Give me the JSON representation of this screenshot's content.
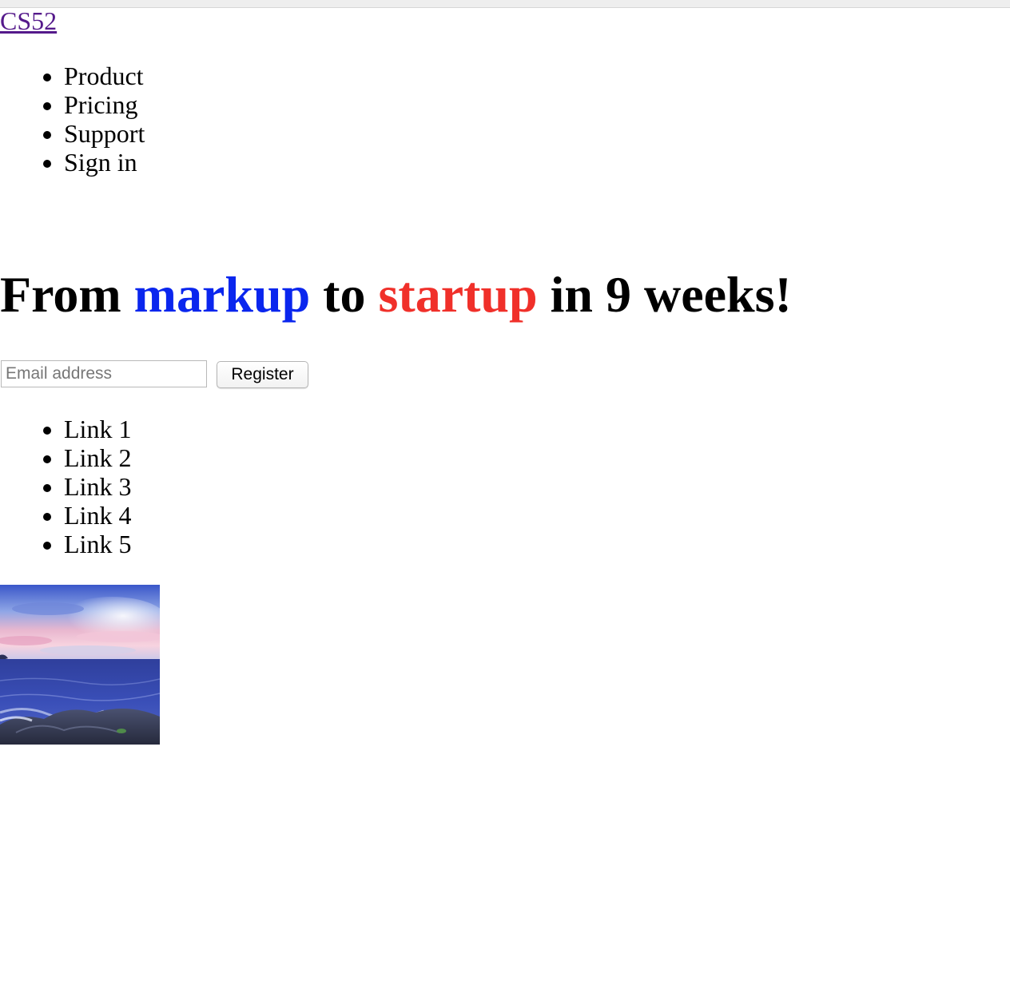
{
  "brand": {
    "label": "CS52",
    "link_color": "#551a8b"
  },
  "nav": {
    "items": [
      "Product",
      "Pricing",
      "Support",
      "Sign in"
    ]
  },
  "headline": {
    "part1": "From ",
    "word_blue": "markup",
    "part2": " to ",
    "word_red": "startup",
    "part3": " in 9 weeks!",
    "blue_color": "#0a26ee",
    "red_color": "#f0302a"
  },
  "signup": {
    "email_placeholder": "Email address",
    "email_value": "",
    "register_label": "Register"
  },
  "links": {
    "items": [
      "Link 1",
      "Link 2",
      "Link 3",
      "Link 4",
      "Link 5"
    ]
  },
  "photo": {
    "icon": "ocean-sunset-image"
  }
}
